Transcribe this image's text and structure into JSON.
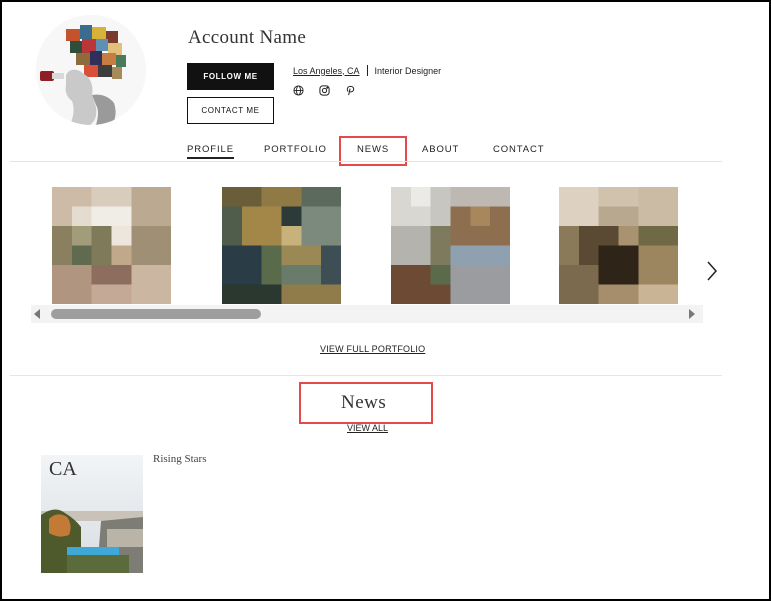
{
  "profile": {
    "account_name": "Account Name",
    "follow_label": "FOLLOW ME",
    "contact_label": "CONTACT ME",
    "location": "Los Angeles, CA",
    "profession": "Interior Designer",
    "social_icons": [
      "globe-icon",
      "instagram-icon",
      "pinterest-icon"
    ]
  },
  "tabs": [
    {
      "label": "PROFILE",
      "active": true
    },
    {
      "label": "PORTFOLIO",
      "active": false
    },
    {
      "label": "NEWS",
      "active": false
    },
    {
      "label": "ABOUT",
      "active": false
    },
    {
      "label": "CONTACT",
      "active": false
    }
  ],
  "portfolio": {
    "view_full_label": "VIEW FULL PORTFOLIO"
  },
  "news": {
    "title": "News",
    "view_all_label": "VIEW ALL",
    "items": [
      {
        "title": "Rising Stars",
        "cover_text": "CA"
      }
    ]
  },
  "highlight_color": "#e34b4b"
}
